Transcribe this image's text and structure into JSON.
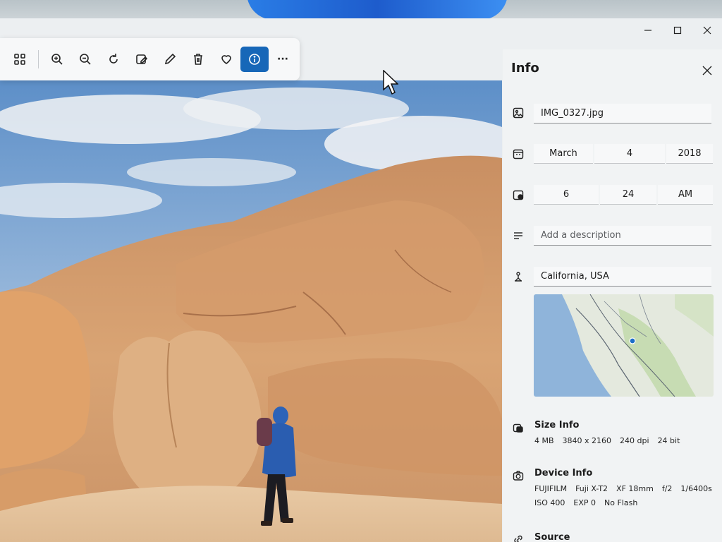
{
  "window": {
    "controls": {
      "minimize": "—",
      "maximize": "☐",
      "close": "✕"
    }
  },
  "toolbar": {
    "buttons": [
      {
        "name": "gallery-icon"
      },
      {
        "name": "zoom-in-icon"
      },
      {
        "name": "zoom-out-icon"
      },
      {
        "name": "rotate-icon"
      },
      {
        "name": "edit-image-icon"
      },
      {
        "name": "draw-icon"
      },
      {
        "name": "delete-icon"
      },
      {
        "name": "favorite-icon"
      },
      {
        "name": "info-icon",
        "active": true
      },
      {
        "name": "more-icon"
      }
    ],
    "more_label": "···"
  },
  "info_panel": {
    "title": "Info",
    "file_name": "IMG_0327.jpg",
    "date": {
      "month": "March",
      "day": "4",
      "year": "2018"
    },
    "time": {
      "hour": "6",
      "minute": "24",
      "period": "AM"
    },
    "description_placeholder": "Add a description",
    "location": "California, USA",
    "size_info": {
      "title": "Size Info",
      "values": [
        "4 MB",
        "3840 x 2160",
        "240 dpi",
        "24 bit"
      ]
    },
    "device_info": {
      "title": "Device Info",
      "line1": [
        "FUJIFILM",
        "Fuji X-T2",
        "XF 18mm",
        "f/2",
        "1/6400s"
      ],
      "line2": [
        "ISO 400",
        "EXP 0",
        "No Flash"
      ]
    },
    "source": {
      "title": "Source"
    }
  },
  "colors": {
    "accent": "#1767b8",
    "panel_bg": "#f1f3f4",
    "sky": "#6f9fd0",
    "rock": "#d9a474"
  }
}
